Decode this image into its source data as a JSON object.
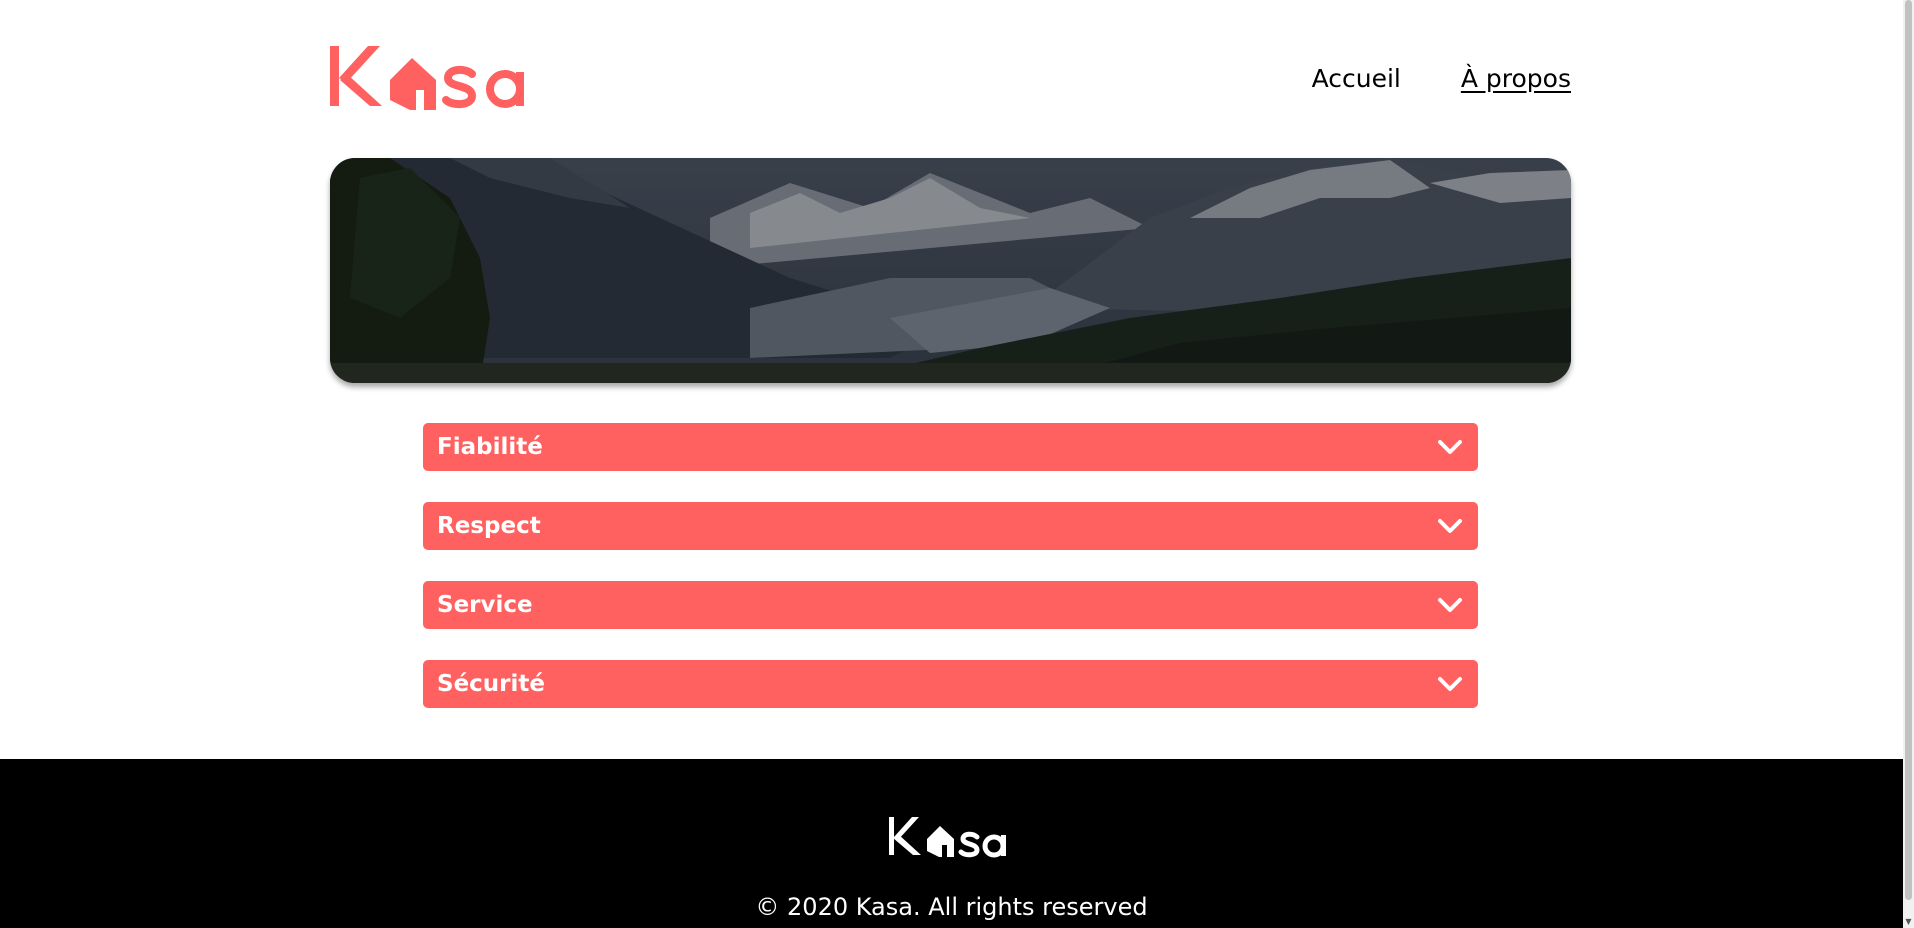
{
  "brand": {
    "logo_text": "Kasa",
    "accent_color": "#ff6060"
  },
  "nav": {
    "items": [
      {
        "label": "Accueil",
        "active": false
      },
      {
        "label": "À propos",
        "active": true
      }
    ]
  },
  "banner": {
    "image": "mountain-valley-landscape"
  },
  "collapses": [
    {
      "title": "Fiabilité",
      "icon": "chevron-down-icon"
    },
    {
      "title": "Respect",
      "icon": "chevron-down-icon"
    },
    {
      "title": "Service",
      "icon": "chevron-down-icon"
    },
    {
      "title": "Sécurité",
      "icon": "chevron-down-icon"
    }
  ],
  "footer": {
    "logo_text": "Kasa",
    "copyright": "© 2020 Kasa. All rights reserved"
  }
}
